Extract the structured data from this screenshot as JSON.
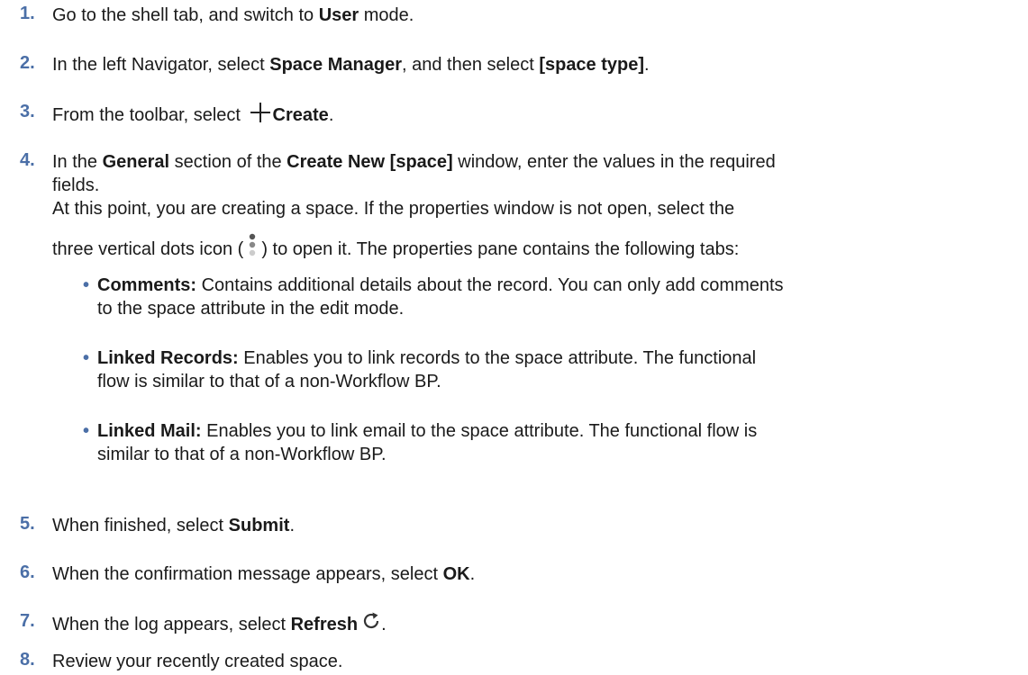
{
  "steps": [
    {
      "num": "1.",
      "a": "Go to the shell tab, and switch to ",
      "b1": "User",
      "c": " mode."
    },
    {
      "num": "2.",
      "a": "In the left Navigator, select ",
      "b1": "Space Manager",
      "c": ", and then select ",
      "b2": "[space type]",
      "d": "."
    },
    {
      "num": "3.",
      "a": "From the toolbar, select ",
      "b1": "Create",
      "c": "."
    },
    {
      "num": "4.",
      "a": "In the ",
      "b1": "General",
      "c": " section of the ",
      "b2": "Create New [space]",
      "d": " window, enter the values in the required",
      "line2": "fields.",
      "line3": "At this point, you are creating a space. If the properties window is not open, select the",
      "line4a": "three vertical dots icon (",
      "line4b": ") to open it. The properties pane contains the following tabs:",
      "bullets": [
        {
          "label": "Comments:",
          "l1": " Contains additional details about the record. You can only add comments",
          "l2": "to the space attribute in the edit mode."
        },
        {
          "label": "Linked Records:",
          "l1": " Enables you to link records to the space attribute. The functional",
          "l2": "flow is similar to that of a non-Workflow BP."
        },
        {
          "label": "Linked Mail:",
          "l1": " Enables you to link email to the space attribute. The functional flow is",
          "l2": "similar to that of a non-Workflow BP."
        }
      ]
    },
    {
      "num": "5.",
      "a": "When finished, select ",
      "b1": "Submit",
      "c": "."
    },
    {
      "num": "6.",
      "a": "When the confirmation message appears, select ",
      "b1": "OK",
      "c": "."
    },
    {
      "num": "7.",
      "a": "When the log appears, select ",
      "b1": "Refresh",
      "c": "."
    },
    {
      "num": "8.",
      "a": "Review your recently created space."
    }
  ],
  "bullet_glyph": "•",
  "icons": {
    "create": "plus-icon",
    "more": "vertical-dots-icon",
    "refresh": "refresh-icon"
  },
  "colors": {
    "step_number": "#4b6fa7",
    "text": "#1a1a1a"
  }
}
